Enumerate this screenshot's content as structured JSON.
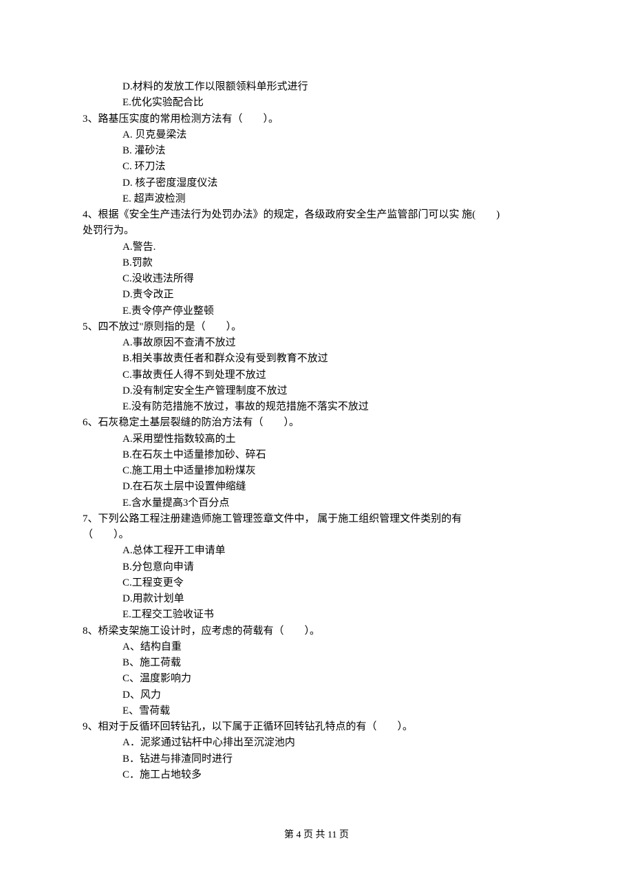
{
  "pre_options": [
    "D.材料的发放工作以限额领料单形式进行",
    "E.优化实验配合比"
  ],
  "questions": [
    {
      "num": "3、",
      "stem": "路基压实度的常用检测方法有（　　）。",
      "options": [
        "A. 贝克曼梁法",
        "B. 灌砂法",
        "C. 环刀法",
        "D. 核子密度湿度仪法",
        "E. 超声波检测"
      ]
    },
    {
      "num": "4、",
      "stem_line1": "根据《安全生产违法行为处罚办法》的规定，各级政府安全生产监管部门可以实 施(　　)",
      "stem_line2": "处罚行为。",
      "options": [
        "A.警告.",
        "B.罚款",
        "C.没收违法所得",
        "D.责令改正",
        "E.责令停产停业整顿"
      ]
    },
    {
      "num": "5、",
      "stem": "四不放过\"原则指的是（　　）。",
      "options": [
        "A.事故原因不查清不放过",
        "B.相关事故责任者和群众没有受到教育不放过",
        "C.事故责任人得不到处理不放过",
        "D.没有制定安全生产管理制度不放过",
        "E.没有防范措施不放过，事故的规范措施不落实不放过"
      ]
    },
    {
      "num": "6、",
      "stem": "石灰稳定土基层裂缝的防治方法有（　　）。",
      "options": [
        "A.采用塑性指数较高的土",
        "B.在石灰土中适量掺加砂、碎石",
        "C.施工用土中适量掺加粉煤灰",
        "D.在石灰土层中设置伸缩缝",
        "E.含水量提高3个百分点"
      ]
    },
    {
      "num": "7、",
      "stem": "下列公路工程注册建造师施工管理签章文件中， 属于施工组织管理文件类别的有",
      "stem_line2": "（　　）。",
      "options": [
        "A.总体工程开工申请单",
        "B.分包意向申请",
        "C.工程变更令",
        "D.用款计划单",
        "E.工程交工验收证书"
      ]
    },
    {
      "num": "8、",
      "stem": "桥梁支架施工设计时，应考虑的荷载有（　　）。",
      "options": [
        "A、结构自重",
        "B、施工荷载",
        "C、温度影响力",
        "D、风力",
        "E、雪荷载"
      ]
    },
    {
      "num": "9、",
      "stem": "相对于反循环回转钻孔，以下属于正循环回转钻孔特点的有（　　）。",
      "options": [
        "A．泥浆通过钻杆中心排出至沉淀池内",
        "B．钻进与排渣同时进行",
        "C．施工占地较多"
      ]
    }
  ],
  "footer": "第 4 页 共 11 页"
}
